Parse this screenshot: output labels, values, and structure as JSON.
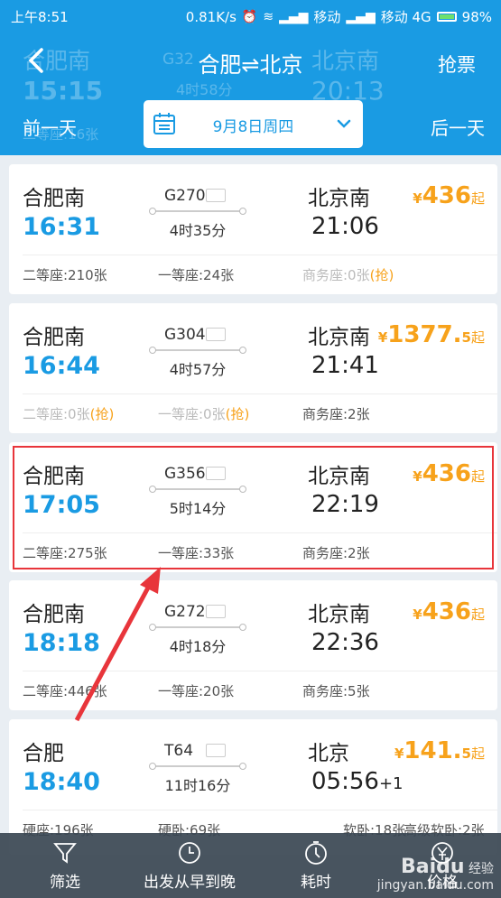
{
  "status_bar": {
    "time": "上午8:51",
    "speed": "0.81K/s",
    "carrier1": "移动",
    "carrier2": "移动 4G",
    "battery": "98%"
  },
  "header": {
    "title": "合肥⇌北京",
    "grab_label": "抢票",
    "prev_day": "前一天",
    "next_day": "后一天",
    "date": "9月8日周四",
    "ghost_from": "合肥南",
    "ghost_dep": "15:15",
    "ghost_train": "G32",
    "ghost_dur": "4时58分",
    "ghost_to": "北京南",
    "ghost_arr": "20:13",
    "ghost_seat": "二等座:16张"
  },
  "trains": [
    {
      "from": "合肥南",
      "dep": "16:31",
      "train": "G270",
      "duration": "4时35分",
      "to": "北京南",
      "arr": "21:06",
      "arr_suffix": "",
      "price_symbol": "¥",
      "price": "436",
      "price_suffix": "起",
      "seats": [
        {
          "text": "二等座:210张",
          "rob": "",
          "gray": false
        },
        {
          "text": "一等座:24张",
          "rob": "",
          "gray": false
        },
        {
          "text": "商务座:0张",
          "rob": "(抢)",
          "gray": true
        }
      ]
    },
    {
      "from": "合肥南",
      "dep": "16:44",
      "train": "G304",
      "duration": "4时57分",
      "to": "北京南",
      "arr": "21:41",
      "arr_suffix": "",
      "price_symbol": "¥",
      "price": "1377.",
      "price_tail": "5",
      "price_suffix": "起",
      "seats": [
        {
          "text": "二等座:0张",
          "rob": "(抢)",
          "gray": true
        },
        {
          "text": "一等座:0张",
          "rob": "(抢)",
          "gray": true
        },
        {
          "text": "商务座:2张",
          "rob": "",
          "gray": false
        }
      ]
    },
    {
      "from": "合肥南",
      "dep": "17:05",
      "train": "G356",
      "duration": "5时14分",
      "to": "北京南",
      "arr": "22:19",
      "arr_suffix": "",
      "price_symbol": "¥",
      "price": "436",
      "price_suffix": "起",
      "seats": [
        {
          "text": "二等座:275张",
          "rob": "",
          "gray": false
        },
        {
          "text": "一等座:33张",
          "rob": "",
          "gray": false
        },
        {
          "text": "商务座:2张",
          "rob": "",
          "gray": false
        }
      ]
    },
    {
      "from": "合肥南",
      "dep": "18:18",
      "train": "G272",
      "duration": "4时18分",
      "to": "北京南",
      "arr": "22:36",
      "arr_suffix": "",
      "price_symbol": "¥",
      "price": "436",
      "price_suffix": "起",
      "seats": [
        {
          "text": "二等座:446张",
          "rob": "",
          "gray": false
        },
        {
          "text": "一等座:20张",
          "rob": "",
          "gray": false
        },
        {
          "text": "商务座:5张",
          "rob": "",
          "gray": false
        }
      ]
    },
    {
      "from": "合肥",
      "dep": "18:40",
      "train": "T64",
      "duration": "11时16分",
      "to": "北京",
      "arr": "05:56",
      "arr_suffix": "+1",
      "price_symbol": "¥",
      "price": "141.",
      "price_tail": "5",
      "price_suffix": "起",
      "seats": [
        {
          "text": "硬座:196张",
          "rob": "",
          "gray": false
        },
        {
          "text": "硬卧:69张",
          "rob": "",
          "gray": false
        },
        {
          "text": "软卧:18张",
          "rob": "",
          "gray": false
        },
        {
          "text": "高级软卧:2张",
          "rob": "",
          "gray": false
        }
      ]
    }
  ],
  "bottom_tabs": [
    {
      "label": "筛选",
      "icon": "filter-icon"
    },
    {
      "label": "出发从早到晚",
      "icon": "clock-icon"
    },
    {
      "label": "耗时",
      "icon": "stopwatch-icon"
    },
    {
      "label": "价格",
      "icon": "price-icon"
    }
  ],
  "watermark": {
    "brand": "Baidu",
    "sub": "经验",
    "url": "jingyan.baidu.com"
  },
  "colors": {
    "primary": "#1a9be3",
    "price": "#f7a21b",
    "highlight": "#e8353b"
  }
}
